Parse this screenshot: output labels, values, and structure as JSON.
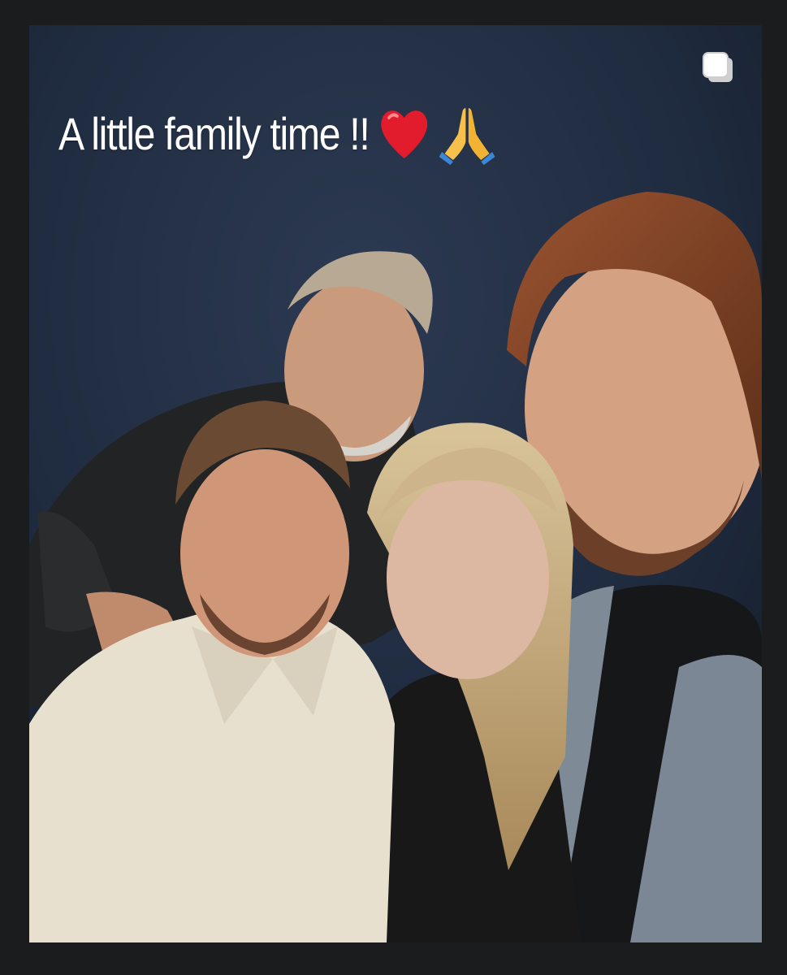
{
  "post": {
    "caption": "A little family time !!",
    "caption_emojis": [
      "red-heart-emoji",
      "folded-hands-emoji"
    ],
    "indicator_icon": "multiple-images-icon"
  },
  "colors": {
    "page_background": "#1b1c1e",
    "backdrop": "#1f2a3c",
    "caption_text": "#ffffff"
  }
}
